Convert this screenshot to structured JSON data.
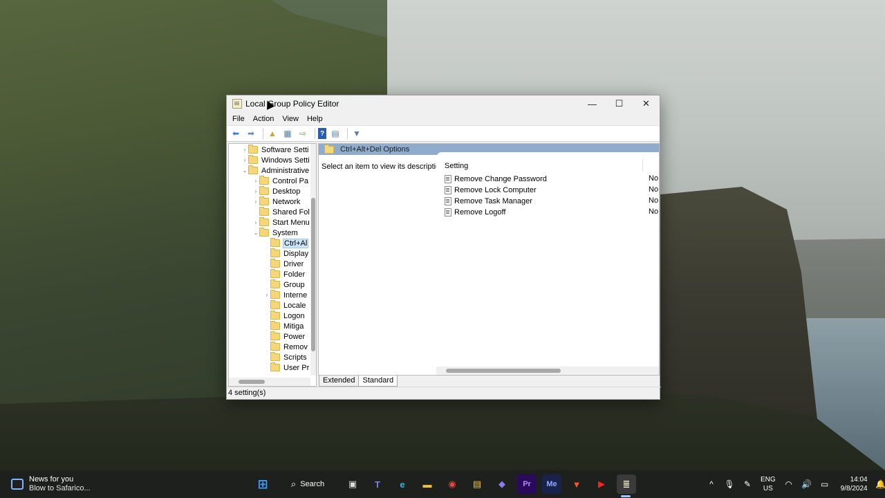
{
  "window": {
    "title": "Local Group Policy Editor",
    "controls": {
      "minimize": "—",
      "maximize": "☐",
      "close": "✕"
    }
  },
  "menu": [
    "File",
    "Action",
    "View",
    "Help"
  ],
  "tree": [
    {
      "label": "Software Settings",
      "expanded": false,
      "selected": false
    },
    {
      "label": "Windows Settings",
      "expanded": false,
      "selected": false
    },
    {
      "label": "Administrative",
      "expanded": true,
      "selected": false
    },
    {
      "label": "Control Panel",
      "expanded": false,
      "selected": false
    },
    {
      "label": "Desktop",
      "expanded": false,
      "selected": false
    },
    {
      "label": "Network",
      "expanded": false,
      "selected": false
    },
    {
      "label": "Shared Folders",
      "expanded": false,
      "selected": false
    },
    {
      "label": "Start Menu",
      "expanded": false,
      "selected": false
    },
    {
      "label": "System",
      "expanded": true,
      "selected": false
    },
    {
      "label": "Ctrl+Alt+Del Options",
      "expanded": false,
      "selected": true
    },
    {
      "label": "Display",
      "expanded": false,
      "selected": false
    },
    {
      "label": "Driver",
      "expanded": false,
      "selected": false
    },
    {
      "label": "Folder",
      "expanded": false,
      "selected": false
    },
    {
      "label": "Group",
      "expanded": false,
      "selected": false
    },
    {
      "label": "Internet",
      "expanded": false,
      "selected": false
    },
    {
      "label": "Locale",
      "expanded": false,
      "selected": false
    },
    {
      "label": "Logon",
      "expanded": false,
      "selected": false
    },
    {
      "label": "Mitigation",
      "expanded": false,
      "selected": false
    },
    {
      "label": "Power",
      "expanded": false,
      "selected": false
    },
    {
      "label": "Removable",
      "expanded": false,
      "selected": false
    },
    {
      "label": "Scripts",
      "expanded": false,
      "selected": false
    },
    {
      "label": "User Profiles",
      "expanded": false,
      "selected": false
    }
  ],
  "tree_visible": [
    "Software Setti",
    "Windows Setti",
    "Administrative",
    "Control Pa",
    "Desktop",
    "Network",
    "Shared Fol",
    "Start Menu",
    "System",
    "Ctrl+Al",
    "Display",
    "Driver",
    "Folder",
    "Group",
    "Interne",
    "Locale",
    "Logon",
    "Mitiga",
    "Power",
    "Remov",
    "Scripts",
    "User Pr"
  ],
  "details": {
    "header": "Ctrl+Alt+Del Options",
    "description": "Select an item to view its description.",
    "column": "Setting",
    "settings": [
      {
        "name": "Remove Change Password",
        "state": "No"
      },
      {
        "name": "Remove Lock Computer",
        "state": "No"
      },
      {
        "name": "Remove Task Manager",
        "state": "No"
      },
      {
        "name": "Remove Logoff",
        "state": "No"
      }
    ]
  },
  "tabs": [
    "Extended",
    "Standard"
  ],
  "status": "4 setting(s)",
  "taskbar": {
    "news_title": "News for you",
    "news_subtitle": "Blow to Safarico...",
    "search_label": "Search",
    "apps": [
      "start",
      "search",
      "task-view",
      "teams",
      "edge",
      "file-explorer",
      "chrome",
      "store",
      "copilot",
      "premiere",
      "media-encoder",
      "brave",
      "youtube",
      "notepad"
    ],
    "lang_top": "ENG",
    "lang_bottom": "US",
    "time": "14:04",
    "date": "9/8/2024"
  }
}
